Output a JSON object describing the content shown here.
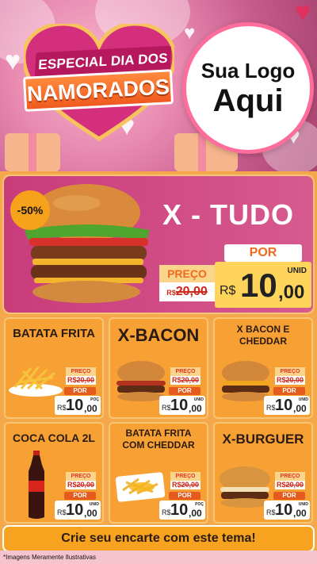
{
  "header": {
    "banner_line1": "ESPECIAL DIA DOS",
    "banner_line2": "NAMORADOS",
    "logo_line1": "Sua Logo",
    "logo_line2": "Aqui"
  },
  "featured": {
    "discount": "-50%",
    "title": "X - TUDO",
    "preco_label": "PREÇO",
    "old_price_currency": "R$",
    "old_price": "20,00",
    "por_label": "POR",
    "new_price_currency": "R$",
    "new_price_int": "10",
    "new_price_cents": ",00",
    "unit": "UNID"
  },
  "products": [
    {
      "name": "BATATA FRITA",
      "preco_label": "PREÇO",
      "old_price_currency": "R$",
      "old_price": "20,00",
      "por_label": "POR",
      "currency": "R$",
      "price_int": "10",
      "price_cents": ",00",
      "unit": "POÇ"
    },
    {
      "name": "X-BACON",
      "preco_label": "PREÇO",
      "old_price_currency": "R$",
      "old_price": "20,00",
      "por_label": "POR",
      "currency": "R$",
      "price_int": "10",
      "price_cents": ",00",
      "unit": "UNID"
    },
    {
      "name": "X BACON E CHEDDAR",
      "preco_label": "PREÇO",
      "old_price_currency": "R$",
      "old_price": "20,00",
      "por_label": "POR",
      "currency": "R$",
      "price_int": "10",
      "price_cents": ",00",
      "unit": "UNID"
    },
    {
      "name": "COCA COLA 2L",
      "preco_label": "PREÇO",
      "old_price_currency": "R$",
      "old_price": "20,00",
      "por_label": "POR",
      "currency": "R$",
      "price_int": "10",
      "price_cents": ",00",
      "unit": "UNID"
    },
    {
      "name": "BATATA FRITA COM CHEDDAR",
      "preco_label": "PREÇO",
      "old_price_currency": "R$",
      "old_price": "20,00",
      "por_label": "POR",
      "currency": "R$",
      "price_int": "10",
      "price_cents": ",00",
      "unit": "POÇ"
    },
    {
      "name": "X-BURGUER",
      "preco_label": "PREÇO",
      "old_price_currency": "R$",
      "old_price": "20,00",
      "por_label": "POR",
      "currency": "R$",
      "price_int": "10",
      "price_cents": ",00",
      "unit": "UNID"
    }
  ],
  "footer": {
    "cta": "Crie seu encarte com este tema!",
    "disclaimer": "*Imagens Meramente Ilustrativas"
  },
  "colors": {
    "accent_pink": "#c83c7a",
    "accent_orange": "#f7a033",
    "price_yellow": "#ffd45a",
    "old_price_red": "#d0271b"
  }
}
